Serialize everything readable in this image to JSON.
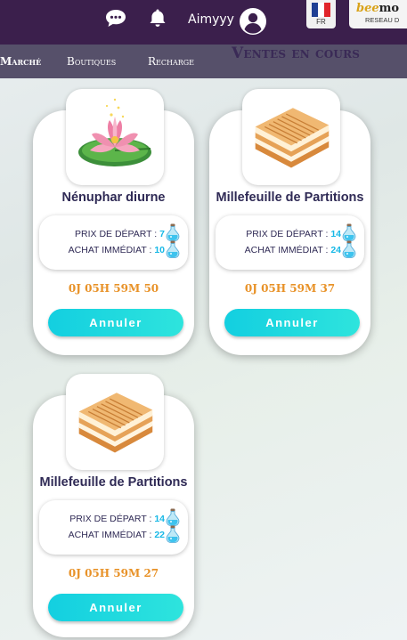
{
  "header": {
    "username": "Aimyyy",
    "language": "FR",
    "partner_logo_a": "bee",
    "partner_logo_b": "mo",
    "partner_sub": "RESEAU D",
    "flag_colors": [
      "#1f3f94",
      "#ffffff",
      "#e0242a"
    ]
  },
  "nav": {
    "items": [
      "Marché",
      "Boutiques",
      "Recharge"
    ],
    "section_title": "Ventes en cours"
  },
  "colors": {
    "topbar": "#3b1f4c",
    "navbar": "#56506a",
    "accent": "#17b8e6",
    "timer": "#e89228",
    "button": "#13cfe0"
  },
  "sales": [
    {
      "name": "Nénuphar diurne",
      "icon": "water-lily-icon",
      "start_label": "Prix de départ :",
      "start_price": "7",
      "buy_label": "Achat immédiat :",
      "buy_price": "10",
      "time_left": "0J 05H 59M 50",
      "button": "Annuler"
    },
    {
      "name": "Millefeuille de Partitions",
      "icon": "millefeuille-icon",
      "start_label": "Prix de départ :",
      "start_price": "14",
      "buy_label": "Achat immédiat :",
      "buy_price": "24",
      "time_left": "0J 05H 59M 37",
      "button": "Annuler"
    },
    {
      "name": "Millefeuille de Partitions",
      "icon": "millefeuille-icon",
      "start_label": "Prix de départ :",
      "start_price": "14",
      "buy_label": "Achat immédiat :",
      "buy_price": "22",
      "time_left": "0J 05H 59M 27",
      "button": "Annuler"
    }
  ]
}
